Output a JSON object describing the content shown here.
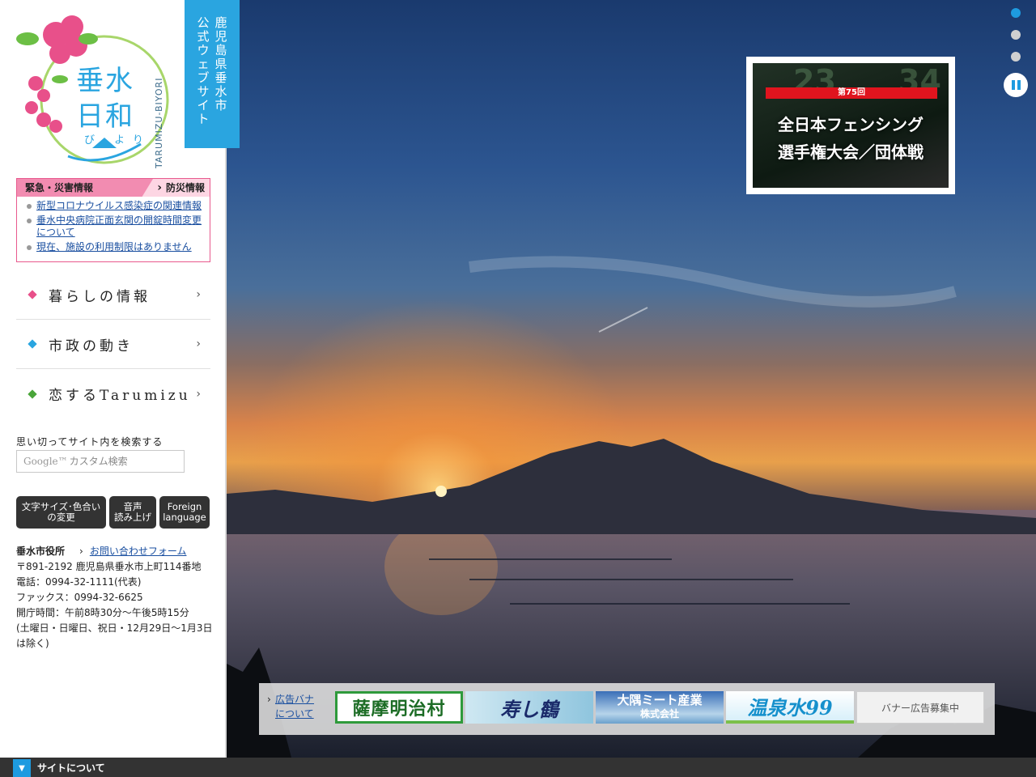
{
  "logo": {
    "title_line1": "垂水",
    "title_line2": "日和",
    "kana": "び より",
    "roman": "TARUMIZU-BIYORI"
  },
  "site_tab": {
    "col1": [
      "鹿",
      "児",
      "島",
      "県",
      "垂",
      "水",
      "市"
    ],
    "col2": [
      "公",
      "式",
      "ウ",
      "ェ",
      "ブ",
      "サ",
      "イ",
      "ト"
    ]
  },
  "emergency": {
    "title": "緊急・災害情報",
    "link": "防災情報",
    "items": [
      "新型コロナウイルス感染症の関連情報",
      "垂水中央病院正面玄関の開錠時間変更について",
      "現在、施設の利用制限はありません"
    ]
  },
  "nav": {
    "items": [
      {
        "label": "暮らしの情報",
        "color": "#e8508a"
      },
      {
        "label": "市政の動き",
        "color": "#2aa5e0"
      },
      {
        "label": "恋するTarumizu",
        "color": "#4aa53a"
      }
    ]
  },
  "search": {
    "label": "思い切ってサイト内を検索する",
    "google": "Google™",
    "placeholder": "カスタム検索"
  },
  "tools": {
    "font": [
      "文字サイズ･色合い",
      "の変更"
    ],
    "voice": [
      "音声",
      "読み上げ"
    ],
    "foreign": [
      "Foreign",
      "language"
    ]
  },
  "office": {
    "name": "垂水市役所",
    "contact": "お問い合わせフォーム",
    "address": "〒891-2192 鹿児島県垂水市上町114番地",
    "tel": "電話：0994-32-1111(代表)",
    "fax": "ファックス：0994-32-6625",
    "hours": "開庁時間：午前8時30分～午後5時15分",
    "closed": "(土曜日・日曜日、祝日・12月29日～1月3日は除く)"
  },
  "feature": {
    "badge": "第75回",
    "line1": "全日本フェンシング",
    "line2": "選手権大会／団体戦",
    "bg_numbers": [
      "23",
      "34"
    ]
  },
  "ads": {
    "label_line1": "広告バナ",
    "label_line2": "について",
    "banner1": "薩摩明治村",
    "banner2": "寿し鶴",
    "banner3_line1": "大隅ミート産業",
    "banner3_line2": "株式会社",
    "banner4": "温泉水99",
    "banner5": "バナー広告募集中"
  },
  "bottom": {
    "label": "サイトについて"
  },
  "colors": {
    "accent_blue": "#2aa5e0",
    "emergency_pink": "#e85a8e"
  }
}
